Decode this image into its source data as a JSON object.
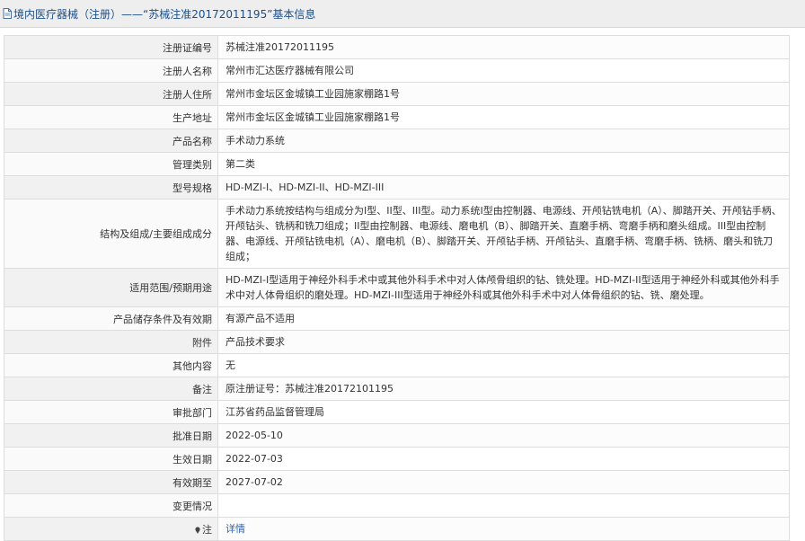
{
  "header": {
    "title": "境内医疗器械（注册）——“苏械注准20172011195”基本信息"
  },
  "rows": [
    {
      "label": "注册证编号",
      "value": "苏械注准20172011195"
    },
    {
      "label": "注册人名称",
      "value": "常州市汇达医疗器械有限公司"
    },
    {
      "label": "注册人住所",
      "value": "常州市金坛区金城镇工业园施家棚路1号"
    },
    {
      "label": "生产地址",
      "value": "常州市金坛区金城镇工业园施家棚路1号"
    },
    {
      "label": "产品名称",
      "value": "手术动力系统"
    },
    {
      "label": "管理类别",
      "value": "第二类"
    },
    {
      "label": "型号规格",
      "value": "HD-MZI-I、HD-MZI-II、HD-MZI-III"
    },
    {
      "label": "结构及组成/主要组成成分",
      "value": "手术动力系统按结构与组成分为I型、II型、III型。动力系统I型由控制器、电源线、开颅钻铣电机（A）、脚踏开关、开颅钻手柄、开颅钻头、铣柄和铣刀组成；II型由控制器、电源线、磨电机（B）、脚踏开关、直磨手柄、弯磨手柄和磨头组成。III型由控制器、电源线、开颅钻铣电机（A）、磨电机（B）、脚踏开关、开颅钻手柄、开颅钻头、直磨手柄、弯磨手柄、铣柄、磨头和铣刀组成；"
    },
    {
      "label": "适用范围/预期用途",
      "value": "HD-MZI-I型适用于神经外科手术中或其他外科手术中对人体颅骨组织的钻、铣处理。HD-MZI-II型适用于神经外科或其他外科手术中对人体骨组织的磨处理。HD-MZI-III型适用于神经外科或其他外科手术中对人体骨组织的钻、铣、磨处理。"
    },
    {
      "label": "产品储存条件及有效期",
      "value": "有源产品不适用"
    },
    {
      "label": "附件",
      "value": "产品技术要求"
    },
    {
      "label": "其他内容",
      "value": "无"
    },
    {
      "label": "备注",
      "value": "原注册证号：苏械注准20172101195"
    },
    {
      "label": "审批部门",
      "value": "江苏省药品监督管理局"
    },
    {
      "label": "批准日期",
      "value": "2022-05-10"
    },
    {
      "label": "生效日期",
      "value": "2022-07-03"
    },
    {
      "label": "有效期至",
      "value": "2027-07-02"
    },
    {
      "label": "变更情况",
      "value": ""
    }
  ],
  "note_row": {
    "label": "注",
    "link": "详情"
  },
  "colors": {
    "link": "#2a62b6",
    "header_text": "#1b4f8a",
    "border": "#dddddd"
  }
}
